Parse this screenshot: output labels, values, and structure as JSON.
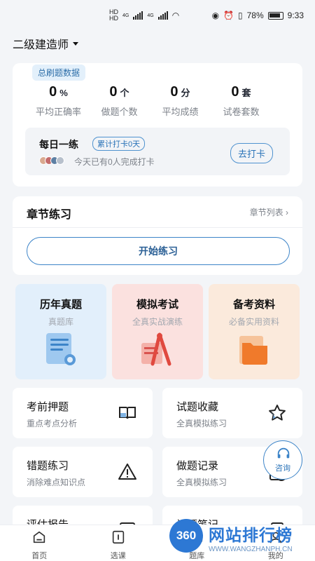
{
  "status_bar": {
    "time": "9:33",
    "battery": "78%",
    "net1": "4G",
    "net2": "4G"
  },
  "header": {
    "title": "二级建造师"
  },
  "stats": {
    "tag": "总刷题数据",
    "items": [
      {
        "value": "0",
        "unit": "%",
        "label": "平均正确率"
      },
      {
        "value": "0",
        "unit": "个",
        "label": "做题个数"
      },
      {
        "value": "0",
        "unit": "分",
        "label": "平均成绩"
      },
      {
        "value": "0",
        "unit": "套",
        "label": "试卷套数"
      }
    ],
    "daily": {
      "title": "每日一练",
      "badge": "累计打卡0天",
      "sub": "今天已有0人完成打卡",
      "button": "去打卡"
    }
  },
  "chapter": {
    "title": "章节练习",
    "link": "章节列表",
    "start": "开始练习"
  },
  "tiles": [
    {
      "title": "历年真题",
      "sub": "真题库"
    },
    {
      "title": "模拟考试",
      "sub": "全真实战演练"
    },
    {
      "title": "备考资料",
      "sub": "必备实用资料"
    }
  ],
  "list": [
    {
      "title": "考前押题",
      "sub": "重点考点分析"
    },
    {
      "title": "试题收藏",
      "sub": "全真模拟练习"
    },
    {
      "title": "错题练习",
      "sub": "消除难点知识点"
    },
    {
      "title": "做题记录",
      "sub": "全真模拟练习"
    },
    {
      "title": "评估报告",
      "sub": ""
    },
    {
      "title": "试题笔记",
      "sub": ""
    }
  ],
  "consult": {
    "label": "咨询"
  },
  "nav": [
    {
      "label": "首页"
    },
    {
      "label": "选课"
    },
    {
      "label": "题库"
    },
    {
      "label": "我的"
    }
  ],
  "watermark": {
    "logo": "360",
    "title": "网站排行榜",
    "url": "WWW.WANGZHANPH.CN"
  },
  "colors": {
    "accent": "#3c84c8",
    "tile_blue": "#e2effb",
    "tile_red": "#fbe1df",
    "tile_orange": "#fbeadc"
  }
}
